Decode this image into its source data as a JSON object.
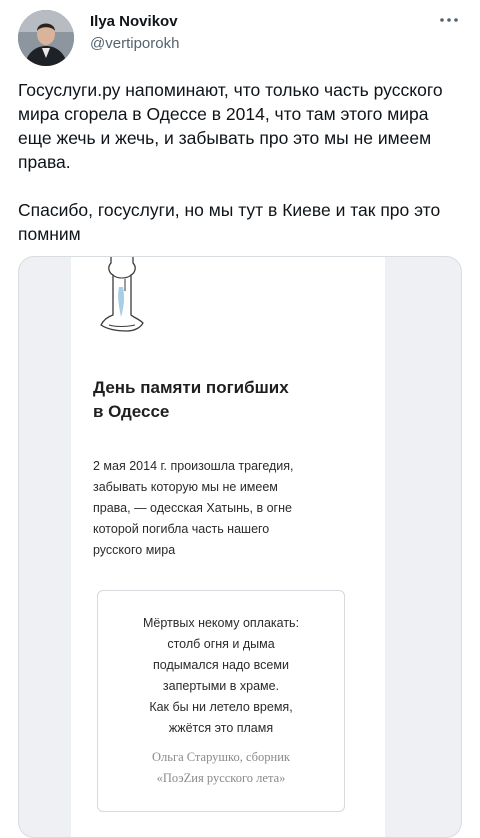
{
  "tweet": {
    "author": {
      "name": "Ilya Novikov",
      "handle": "@vertiporokh"
    },
    "text_paragraph_1": "Госуслуги.ру напоминают, что только часть русского мира сгорела в Одессе в 2014, что там этого мира еще жечь и жечь, и забывать про это мы не имеем права.",
    "text_paragraph_2": "Спасибо, госуслуги, но мы тут в Киеве и так про это помним"
  },
  "icons": {
    "more": "more-dots-icon",
    "candle": "candle-icon"
  },
  "email": {
    "title_line_1": "День памяти погибших",
    "title_line_2": "в Одессе",
    "body_lines": [
      "2 мая 2014 г. произошла трагедия,",
      "забывать которую мы не имеем",
      "права, — одесская Хатынь, в огне",
      "которой погибла часть нашего",
      "русского мира"
    ],
    "poem_lines": [
      "Мёртвых некому оплакать:",
      "столб огня и дыма",
      "подымался надо всеми",
      "запертыми в храме.",
      "Как бы ни летело время,",
      "жжётся это пламя"
    ],
    "poem_source_line_1": "Ольга Старушко, сборник",
    "poem_source_line_2": "«ПоэZия русского лета»"
  },
  "colors": {
    "text_primary": "#0f1419",
    "text_secondary": "#536471",
    "card_border": "#d8dde1",
    "card_background": "#eef0f3",
    "candle_blue": "#a8cde6"
  }
}
